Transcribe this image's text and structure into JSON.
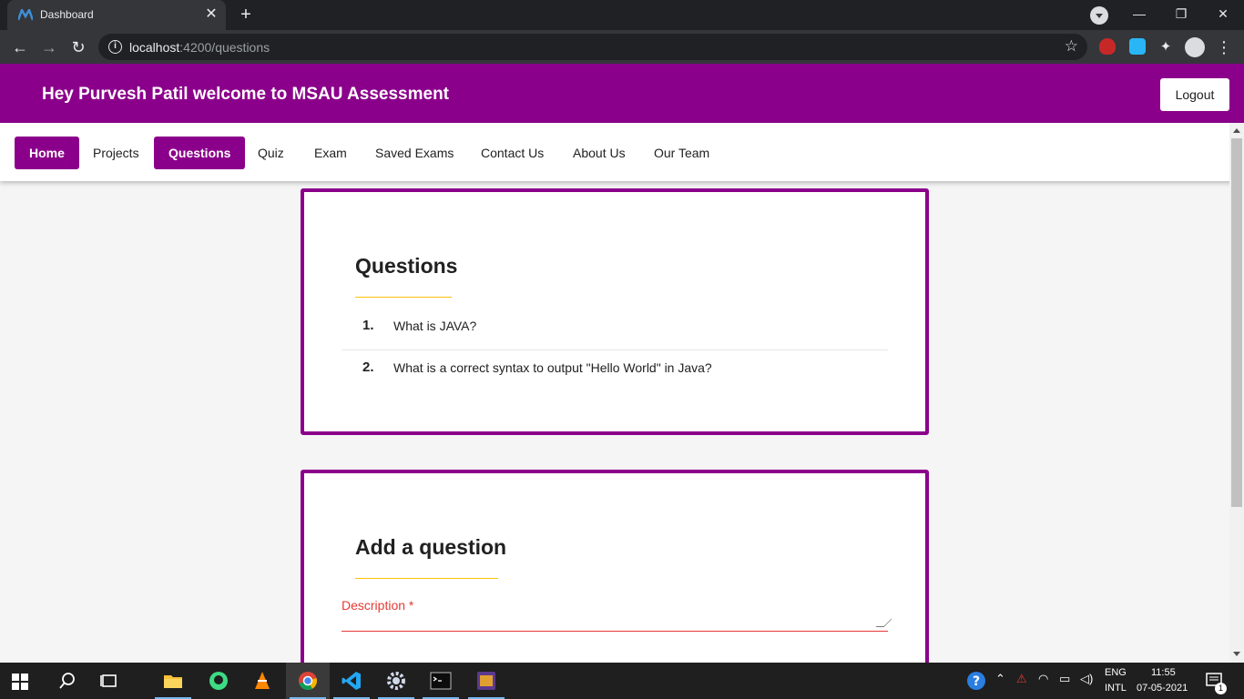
{
  "browser": {
    "tab_title": "Dashboard",
    "url_host": "localhost",
    "url_rest": ":4200/questions"
  },
  "header": {
    "title": "Hey Purvesh Patil welcome to MSAU Assessment",
    "logout_label": "Logout"
  },
  "nav": {
    "items": [
      {
        "label": "Home",
        "active": true
      },
      {
        "label": "Projects",
        "active": false
      },
      {
        "label": "Questions",
        "active": true
      },
      {
        "label": "Quiz",
        "active": false
      },
      {
        "label": "Exam",
        "active": false
      },
      {
        "label": "Saved Exams",
        "active": false
      },
      {
        "label": "Contact Us",
        "active": false
      },
      {
        "label": "About Us",
        "active": false
      },
      {
        "label": "Our Team",
        "active": false
      }
    ]
  },
  "questions_card": {
    "title": "Questions",
    "items": [
      {
        "num": "1.",
        "text": "What is JAVA?"
      },
      {
        "num": "2.",
        "text": "What is a correct syntax to output \"Hello World\" in Java?"
      }
    ]
  },
  "add_card": {
    "title": "Add a question",
    "description_label": "Description *"
  },
  "taskbar": {
    "lang_top": "ENG",
    "lang_bottom": "INTL",
    "time": "11:55",
    "date": "07-05-2021",
    "notification_count": "1"
  },
  "colors": {
    "brand": "#8b008b",
    "accent_underline": "#ffc107",
    "error": "#e53935"
  }
}
